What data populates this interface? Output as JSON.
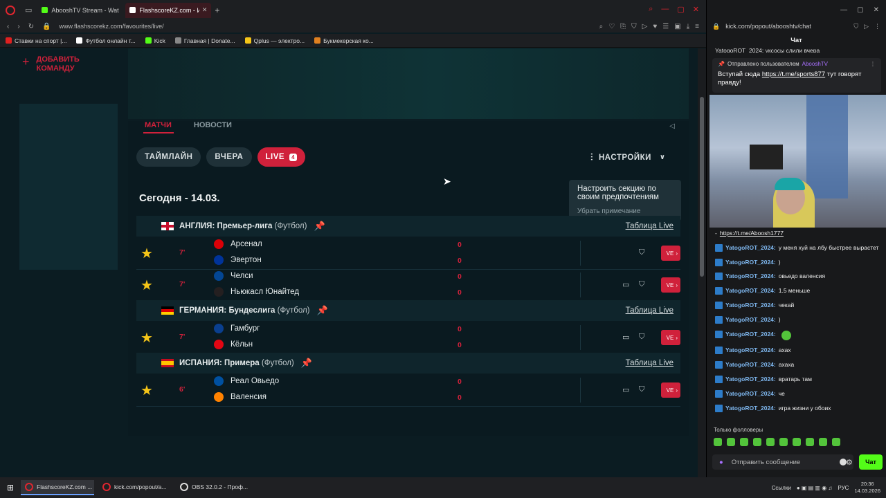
{
  "browser": {
    "tabs": [
      {
        "title": "AbooshTV Stream - Watch",
        "color": "#53fc18",
        "active": false
      },
      {
        "title": "FlashscoreKZ.com - Избр",
        "color": "#ffffff",
        "active": true
      }
    ],
    "url": "www.flashscorekz.com/favourites/live/",
    "bookmarks": [
      {
        "label": "Ставки на спорт |...",
        "color": "#e02020"
      },
      {
        "label": "Футбол онлайн т...",
        "color": "#ffffff"
      },
      {
        "label": "Kick",
        "color": "#53fc18"
      },
      {
        "label": "Главная | Donate...",
        "color": "#888888"
      },
      {
        "label": "Qplus — электро...",
        "color": "#f5c518"
      },
      {
        "label": "Букмекерская ко...",
        "color": "#e08020"
      }
    ]
  },
  "sidebar": {
    "add_team": "ДОБАВИТЬ КОМАНДУ",
    "plus": "+"
  },
  "content": {
    "hidden_tabs": [
      "МАТЧИ",
      "НОВОСТИ"
    ],
    "filters": [
      {
        "label": "ТАЙМЛАЙН",
        "active": false
      },
      {
        "label": "ВЧЕРА",
        "active": false
      },
      {
        "label": "LIVE",
        "active": true,
        "badge": "4"
      }
    ],
    "settings_label": "НАСТРОЙКИ",
    "tooltip": {
      "text": "Настроить секцию по своим предпочтениям",
      "link": "Убрать примечание"
    },
    "date_heading": "Сегодня - 14.03.",
    "table_live": "Таблица Live",
    "live_btn": "VE",
    "leagues": [
      {
        "country": "АНГЛИЯ:",
        "name": "Премьер-лига",
        "sport": "(Футбол)",
        "matches": [
          {
            "minute": "7'",
            "home": "Арсенал",
            "away": "Эвертон",
            "home_score": "0",
            "away_score": "0",
            "tv": false
          },
          {
            "minute": "7'",
            "home": "Челси",
            "away": "Ньюкасл Юнайтед",
            "home_score": "0",
            "away_score": "0",
            "tv": true
          }
        ]
      },
      {
        "country": "ГЕРМАНИЯ:",
        "name": "Бундеслига",
        "sport": "(Футбол)",
        "matches": [
          {
            "minute": "7'",
            "home": "Гамбург",
            "away": "Кёльн",
            "home_score": "0",
            "away_score": "0",
            "tv": true
          }
        ]
      },
      {
        "country": "ИСПАНИЯ:",
        "name": "Примера",
        "sport": "(Футбол)",
        "matches": [
          {
            "minute": "6'",
            "home": "Реал Овьедо",
            "away": "Валенсия",
            "home_score": "0",
            "away_score": "0",
            "tv": true
          }
        ]
      }
    ]
  },
  "chat": {
    "url": "kick.com/popout/abooshtv/chat",
    "title": "Чат",
    "top_line": "YatogoROT_2024: уксосы слили вчера",
    "pinned": {
      "header": "Отправлено пользователем",
      "by": "AbooshTV",
      "text_before": "Вступай сюда ",
      "link": "https://t.me/sports877",
      "text_after": " тут говорят правду!"
    },
    "link_line": "https://t.me/Aboosh1777",
    "link_prefix": "- ",
    "messages": [
      {
        "user": "YatogoROT_2024:",
        "text": "у меня хуй на лбу быстрее вырастет"
      },
      {
        "user": "YatogoROT_2024:",
        "text": ")"
      },
      {
        "user": "YatogoROT_2024:",
        "text": "овьедо валенсия"
      },
      {
        "user": "YatogoROT_2024:",
        "text": "1.5 меньше"
      },
      {
        "user": "YatogoROT_2024:",
        "text": "чекай"
      },
      {
        "user": "YatogoROT_2024:",
        "text": ")"
      },
      {
        "user": "YatogoROT_2024:",
        "text": "",
        "emote": true
      },
      {
        "user": "YatogoROT_2024:",
        "text": "ахах"
      },
      {
        "user": "YatogoROT_2024:",
        "text": "ахаха"
      },
      {
        "user": "YatogoROT_2024:",
        "text": "вратарь там"
      },
      {
        "user": "YatogoROT_2024:",
        "text": "че"
      },
      {
        "user": "YatogoROT_2024:",
        "text": "игра жизни у обоих"
      }
    ],
    "followers_only": "Только фолловеры",
    "input_placeholder": "Отправить сообщение",
    "send_label": "Чат"
  },
  "taskbar": {
    "tasks": [
      {
        "label": "FlashscoreKZ.com ...",
        "active": true,
        "icon": "opera"
      },
      {
        "label": "kick.com/popout/a...",
        "active": false,
        "icon": "opera"
      },
      {
        "label": "OBS 32.0.2 - Проф...",
        "active": false,
        "icon": "obs"
      }
    ],
    "links_label": "Ссылки",
    "lang": "РУС",
    "time": "20:36",
    "date": "14.03.2026"
  }
}
